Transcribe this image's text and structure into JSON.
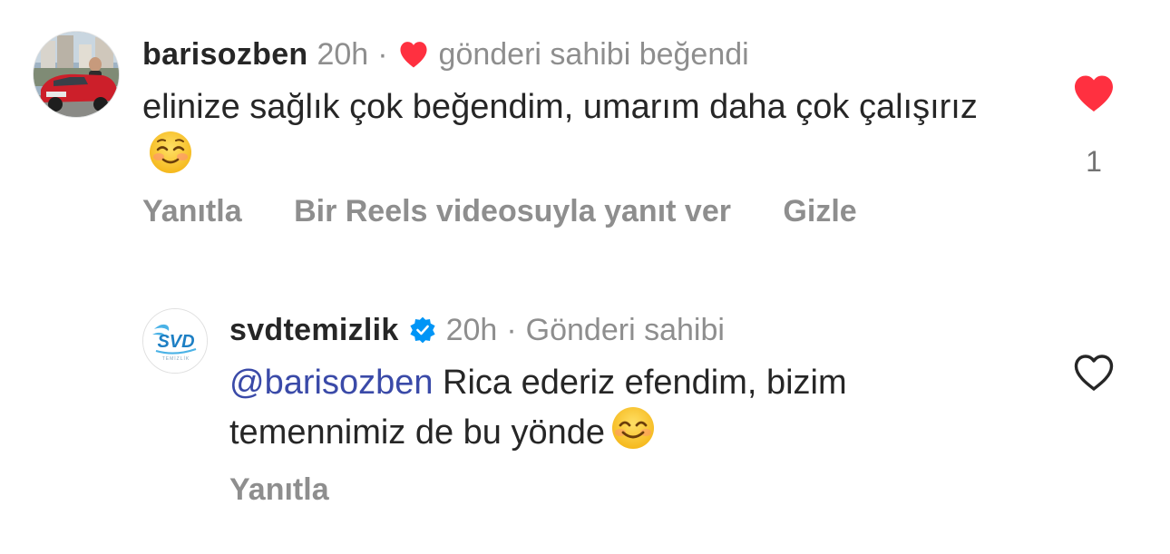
{
  "comment": {
    "username": "barisozben",
    "time": "20h",
    "separator": "·",
    "liked_by_author_text": "gönderi sahibi beğendi",
    "text": "elinize sağlık çok beğendim, umarım daha çok çalışırız",
    "emoji": "smiling-face-emoji",
    "like_count": "1",
    "liked": true,
    "actions": {
      "reply": "Yanıtla",
      "reels_reply": "Bir Reels videosuyla yanıt ver",
      "hide": "Gizle"
    }
  },
  "reply": {
    "username": "svdtemizlik",
    "verified": true,
    "time": "20h",
    "separator": "·",
    "author_badge": "Gönderi sahibi",
    "mention": "@barisozben",
    "text": "Rica ederiz efendim, bizim temennimiz de bu yönde",
    "emoji": "smiling-face-with-smiling-eyes-emoji",
    "liked": false,
    "actions": {
      "reply": "Yanıtla"
    },
    "avatar_logo_text": "SVD",
    "avatar_logo_subtext": "TEMİZLİK"
  },
  "colors": {
    "heart_red": "#ff3040",
    "verified_blue": "#0095f6",
    "mention_blue": "#3a4aa8",
    "secondary_text": "#8e8e8e"
  }
}
